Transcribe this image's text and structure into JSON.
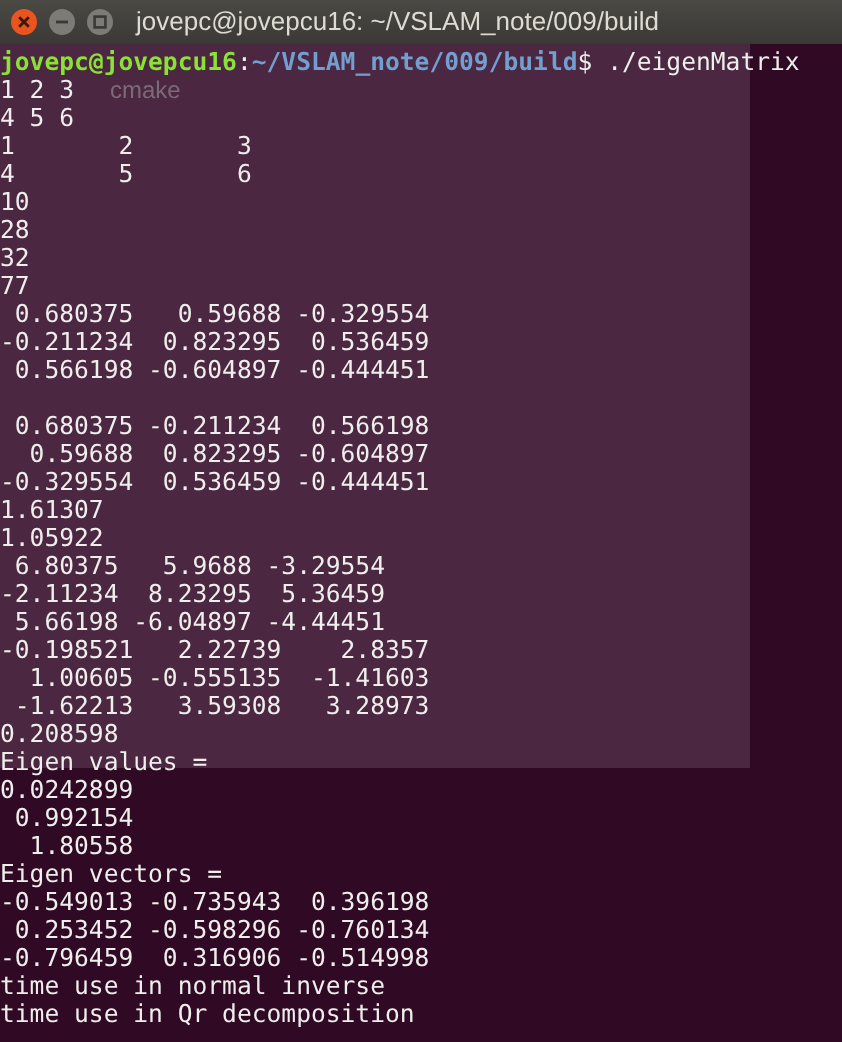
{
  "window": {
    "title": "jovepc@jovepcu16: ~/VSLAM_note/009/build"
  },
  "prompt": {
    "user_host": "jovepc@jovepcu16",
    "separator": ":",
    "path": "~/VSLAM_note/009/build",
    "symbol": "$",
    "command": "./eigenMatrix"
  },
  "ghost_text": "cmake",
  "lines": [
    {
      "kind": "output",
      "text": "1 2 3"
    },
    {
      "kind": "output",
      "text": "4 5 6"
    },
    {
      "kind": "output",
      "text": "1       2       3"
    },
    {
      "kind": "output",
      "text": "4       5       6"
    },
    {
      "kind": "output",
      "text": "10"
    },
    {
      "kind": "output",
      "text": "28"
    },
    {
      "kind": "output",
      "text": "32"
    },
    {
      "kind": "output",
      "text": "77"
    },
    {
      "kind": "output",
      "text": " 0.680375   0.59688 -0.329554"
    },
    {
      "kind": "output",
      "text": "-0.211234  0.823295  0.536459"
    },
    {
      "kind": "output",
      "text": " 0.566198 -0.604897 -0.444451"
    },
    {
      "kind": "blank"
    },
    {
      "kind": "output",
      "text": " 0.680375 -0.211234  0.566198"
    },
    {
      "kind": "output",
      "text": "  0.59688  0.823295 -0.604897"
    },
    {
      "kind": "output",
      "text": "-0.329554  0.536459 -0.444451"
    },
    {
      "kind": "output",
      "text": "1.61307"
    },
    {
      "kind": "output",
      "text": "1.05922"
    },
    {
      "kind": "output",
      "text": " 6.80375   5.9688 -3.29554"
    },
    {
      "kind": "output",
      "text": "-2.11234  8.23295  5.36459"
    },
    {
      "kind": "output",
      "text": " 5.66198 -6.04897 -4.44451"
    },
    {
      "kind": "output",
      "text": "-0.198521   2.22739    2.8357"
    },
    {
      "kind": "output",
      "text": "  1.00605 -0.555135  -1.41603"
    },
    {
      "kind": "output",
      "text": " -1.62213   3.59308   3.28973"
    },
    {
      "kind": "output",
      "text": "0.208598"
    },
    {
      "kind": "output",
      "text": "Eigen values ="
    },
    {
      "kind": "output",
      "text": "0.0242899"
    },
    {
      "kind": "output",
      "text": " 0.992154"
    },
    {
      "kind": "output",
      "text": "  1.80558"
    },
    {
      "kind": "output",
      "text": "Eigen vectors ="
    },
    {
      "kind": "output",
      "text": "-0.549013 -0.735943  0.396198"
    },
    {
      "kind": "output",
      "text": " 0.253452 -0.598296 -0.760134"
    },
    {
      "kind": "output",
      "text": "-0.796459  0.316906 -0.514998"
    },
    {
      "kind": "output",
      "text": "time use in normal inverse"
    },
    {
      "kind": "output",
      "text": "time use in Qr decomposition"
    }
  ]
}
